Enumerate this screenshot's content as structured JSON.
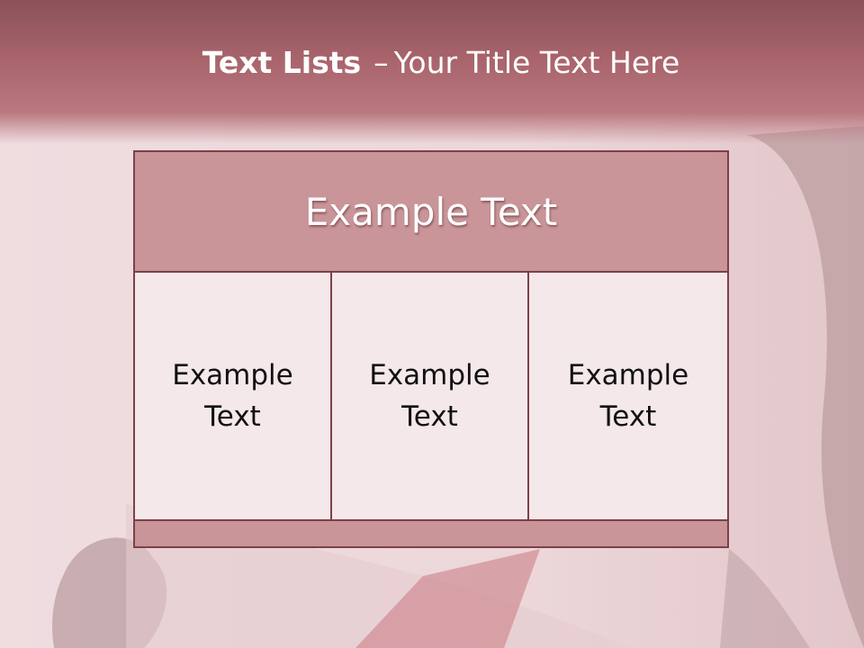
{
  "slide": {
    "title_bold": "Text Lists",
    "title_dash": "–",
    "title_rest": "Your Title Text Here"
  },
  "panel": {
    "header": "Example Text",
    "columns": [
      "Example Text",
      "Example Text",
      "Example Text"
    ]
  },
  "colors": {
    "accent": "#a8636b",
    "border": "#7d4048",
    "header_fill": "#c99599",
    "cell_fill": "#f4e8ea"
  }
}
